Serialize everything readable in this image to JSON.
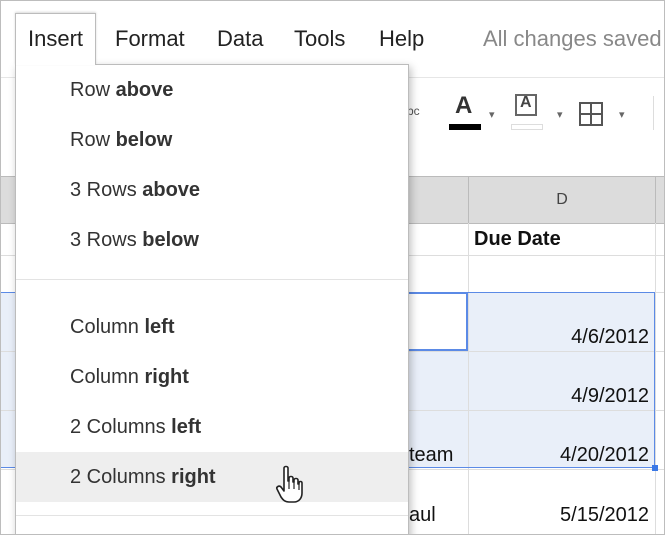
{
  "menubar": {
    "items": [
      {
        "label": "Insert"
      },
      {
        "label": "Format"
      },
      {
        "label": "Data"
      },
      {
        "label": "Tools"
      },
      {
        "label": "Help"
      }
    ],
    "status": "All changes saved"
  },
  "toolbar": {
    "abc_label": "Abc",
    "text_color_letter": "A",
    "fill_letter": "A",
    "text_color_value": "#000000",
    "fill_color_value": "#ffffff"
  },
  "sheet": {
    "column_header": "D",
    "header_cell": "Due Date",
    "rows": [
      {
        "c": "",
        "d": "4/6/2012"
      },
      {
        "c": "",
        "d": "4/9/2012"
      },
      {
        "c": "team",
        "d": "4/20/2012"
      },
      {
        "c": "aul",
        "d": "5/15/2012"
      }
    ],
    "selection_color": "#5b8ae6"
  },
  "insert_menu": {
    "items": [
      {
        "prefix": "Row ",
        "bold": "above"
      },
      {
        "prefix": "Row ",
        "bold": "below"
      },
      {
        "prefix": "3 Rows ",
        "bold": "above"
      },
      {
        "prefix": "3 Rows ",
        "bold": "below"
      },
      {
        "prefix": "Column ",
        "bold": "left"
      },
      {
        "prefix": "Column ",
        "bold": "right"
      },
      {
        "prefix": "2 Columns ",
        "bold": "left"
      },
      {
        "prefix": "2 Columns ",
        "bold": "right"
      }
    ],
    "hovered_index": 7
  },
  "icons": {
    "cursor": "hand-pointer-icon",
    "dropdown": "caret-down-icon",
    "borders": "borders-grid-icon"
  }
}
